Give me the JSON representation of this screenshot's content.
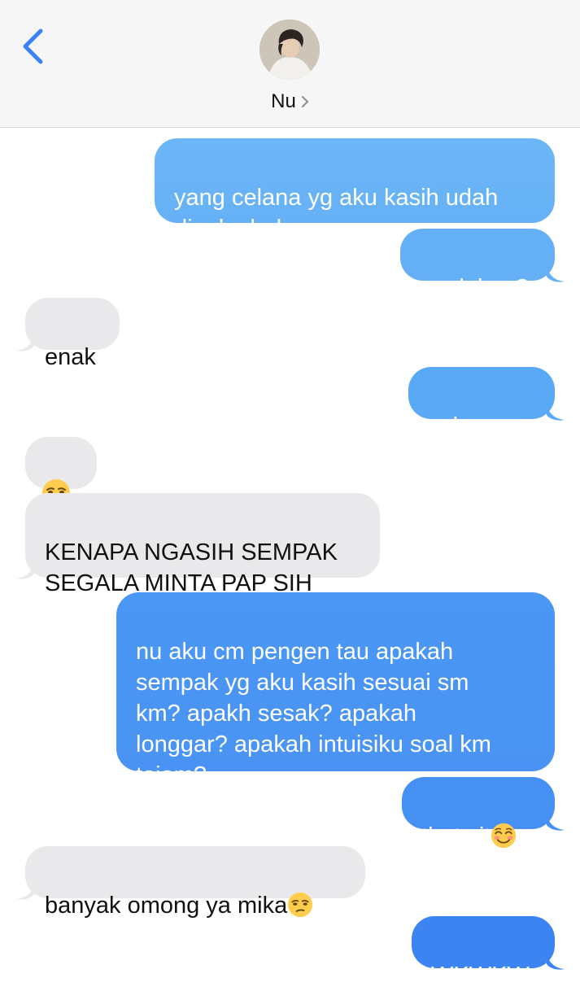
{
  "header": {
    "contact_name": "Nu",
    "avatar_icon": "contact-photo"
  },
  "messages": [
    {
      "id": "m1",
      "side": "sent",
      "text": "yang celana yg aku kasih udah\ndipake belum"
    },
    {
      "id": "m2",
      "side": "sent",
      "text": "enak kan?"
    },
    {
      "id": "m3",
      "side": "recv",
      "text": "enak"
    },
    {
      "id": "m4",
      "side": "sent",
      "text": "coba pap"
    },
    {
      "id": "m5",
      "side": "recv",
      "text": "",
      "emoji": "unamused-face"
    },
    {
      "id": "m6",
      "side": "recv",
      "text": "KENAPA NGASIH SEMPAK\nSEGALA MINTA PAP SIH"
    },
    {
      "id": "m7",
      "side": "sent",
      "text": "nu aku cm pengen tau apakah\nsempak yg aku kasih sesuai sm\nkm? apakh sesak? apakah\nlonggar? apakah intuisiku soal km\ntajam?"
    },
    {
      "id": "m8",
      "side": "sent",
      "text": "thats it",
      "emoji": "smiling-face"
    },
    {
      "id": "m9",
      "side": "recv",
      "text": "banyak omong ya mika",
      "emoji": "unamused-face"
    },
    {
      "id": "m10",
      "side": "sent",
      "text": "WKWKW"
    }
  ],
  "colors": {
    "sent_bubble_top": "#6bb5f7",
    "sent_bubble_bottom": "#3a86f2",
    "received_bubble": "#e9e9eb",
    "accent": "#3b82f6"
  }
}
